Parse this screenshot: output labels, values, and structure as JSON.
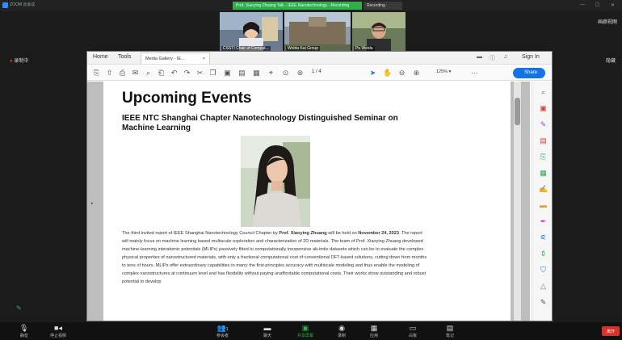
{
  "zoom": {
    "window_title": "ZOOM 云会议",
    "banner": "Prof. Xiaoying Zhuang Talk - IEEE Nanotechnology - Recording",
    "banner_right": "Recording",
    "left_status": "录制中",
    "right_label": "画廊视图",
    "right_label2": "隐藏",
    "participants": [
      {
        "name": "CSSTI Chair of Comput..."
      },
      {
        "name": "Wolda Kai Group"
      },
      {
        "name": "Pu Weida"
      }
    ],
    "bottom": {
      "mute": "静音",
      "video": "停止视频",
      "participants": "参会者",
      "participants_count": "1",
      "chat": "聊天",
      "share": "共享屏幕",
      "record": "录制",
      "apps": "应用",
      "whiteboard": "白板",
      "notes": "笔记",
      "end": "离开"
    }
  },
  "acrobat": {
    "menu": {
      "home": "Home",
      "tools": "Tools",
      "tab": "Media Gallery - IE...",
      "sign_in": "Sign In"
    },
    "toolbar": {
      "page": "1",
      "of": "/ 4",
      "zoom": "125%",
      "share": "Share"
    }
  },
  "document": {
    "heading": "Upcoming Events",
    "subheading": "IEEE NTC Shanghai Chapter Nanotechnology Distinguished Seminar on Machine Learning",
    "photo_alt": "Portrait of Prof. Xiaoying Zhuang",
    "para_a": "The third invited report of IEEE Shanghai Nanotechnology Council Chapter by ",
    "para_name": "Prof. Xiaoying Zhuang",
    "para_b": " will be held on ",
    "para_date": "November 24, 2023",
    "para_c": ". The report will mainly focus on machine learning based multiscale exploration and characterization of 2D materials. The team of Prof. Xiaoying Zhuang developed machine-learning interatomic potentials (MLIPs) passively fitted to computationally inexpensive ab-initio datasets which can be to evaluate the complex physical properties of nanostructured materials, with only a fractional computational cost of conventional DFT-based solutions, cutting down from months to tens of hours. MLIPs offer extraordinary capabilities to marry the first-principles accuracy with multiscale modeling and thus enable the modeling of complex nanostructures at continuum level and has flexibility without paying unaffordable computational costs. Their works show outstanding and robust potential to develop"
  }
}
